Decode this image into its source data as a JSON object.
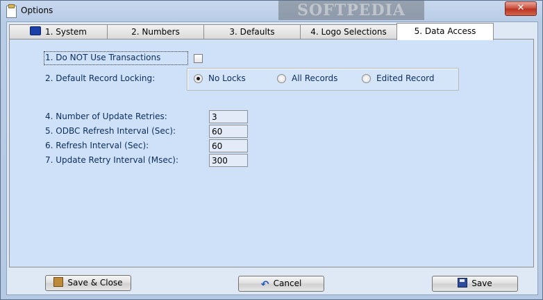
{
  "window": {
    "title": "Options",
    "close_glyph": "✕",
    "watermark": "SOFTPEDIA"
  },
  "tabs": [
    {
      "label": "1. System",
      "icon": "computer-icon"
    },
    {
      "label": "2. Numbers"
    },
    {
      "label": "3. Defaults"
    },
    {
      "label": "4. Logo Selections"
    },
    {
      "label": "5. Data Access",
      "active": true
    }
  ],
  "data_access": {
    "no_transactions": {
      "label": "1. Do NOT Use Transactions",
      "checked": false
    },
    "record_locking": {
      "label": "2. Default Record Locking:",
      "options": [
        "No Locks",
        "All Records",
        "Edited Record"
      ],
      "selected": "No Locks"
    },
    "fields": [
      {
        "label": "4. Number of Update Retries:",
        "value": "3"
      },
      {
        "label": "5. ODBC Refresh Interval (Sec):",
        "value": "60"
      },
      {
        "label": "6. Refresh Interval (Sec):",
        "value": "60"
      },
      {
        "label": "7. Update Retry Interval (Msec):",
        "value": "300"
      }
    ]
  },
  "buttons": {
    "save_close": {
      "label": "Save & Close",
      "icon": "save-close-icon"
    },
    "cancel": {
      "label": "Cancel",
      "icon": "undo-icon",
      "glyph": "↶"
    },
    "save": {
      "label": "Save",
      "icon": "floppy-disk-icon"
    }
  }
}
